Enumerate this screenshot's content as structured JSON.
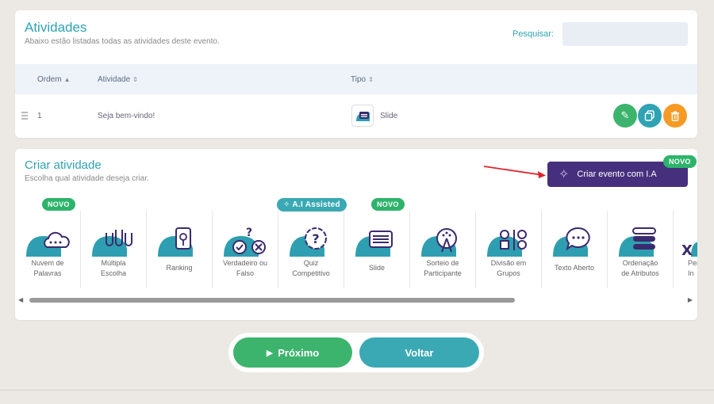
{
  "activities": {
    "title": "Atividades",
    "subtitle": "Abaixo estão listadas todas as atividades deste evento.",
    "search_label": "Pesquisar:",
    "search_value": "",
    "columns": {
      "order": "Ordem",
      "activity": "Atividade",
      "type": "Tipo"
    },
    "sort_icons": {
      "order": "▲",
      "activity": "⇕",
      "type": "⇕"
    },
    "rows": [
      {
        "order": "1",
        "name": "Seja bem-vindo!",
        "type": "Slide",
        "type_icon": "slide-icon"
      }
    ],
    "actions": {
      "edit_icon": "pencil-icon",
      "copy_icon": "copy-icon",
      "delete_icon": "trash-icon"
    }
  },
  "create": {
    "title": "Criar atividade",
    "subtitle": "Escolha qual atividade deseja criar.",
    "ai_button_label": "Criar evento com I.A",
    "ai_badge": "NOVO",
    "tiles": [
      {
        "label1": "Nuvem de",
        "label2": "Palavras",
        "badge": "NOVO",
        "icon": "word-cloud-icon"
      },
      {
        "label1": "Múltipla",
        "label2": "Escolha",
        "badge": "",
        "icon": "multiple-choice-icon"
      },
      {
        "label1": "Ranking",
        "label2": "",
        "badge": "",
        "icon": "ranking-icon"
      },
      {
        "label1": "Verdadeiro ou",
        "label2": "Falso",
        "badge": "",
        "icon": "true-false-icon"
      },
      {
        "label1": "Quiz",
        "label2": "Competitivo",
        "badge": "A.I Assisted",
        "icon": "quiz-icon"
      },
      {
        "label1": "Slide",
        "label2": "",
        "badge": "NOVO",
        "icon": "slide-icon"
      },
      {
        "label1": "Sorteio de",
        "label2": "Participante",
        "badge": "",
        "icon": "raffle-icon"
      },
      {
        "label1": "Divisão em",
        "label2": "Grupos",
        "badge": "",
        "icon": "groups-icon"
      },
      {
        "label1": "Texto Aberto",
        "label2": "",
        "badge": "",
        "icon": "open-text-icon"
      },
      {
        "label1": "Ordenação",
        "label2": "de Atributos",
        "badge": "",
        "icon": "ordering-icon"
      },
      {
        "label1": "Per",
        "label2": "In",
        "badge": "",
        "icon": "partial-tile-icon"
      }
    ]
  },
  "footer": {
    "next_label": "Próximo",
    "back_label": "Voltar"
  },
  "colors": {
    "teal": "#2fa3b3",
    "green": "#3db46d",
    "purple": "#46307d",
    "orange": "#f59b25",
    "blob": "#2e9fb0"
  }
}
